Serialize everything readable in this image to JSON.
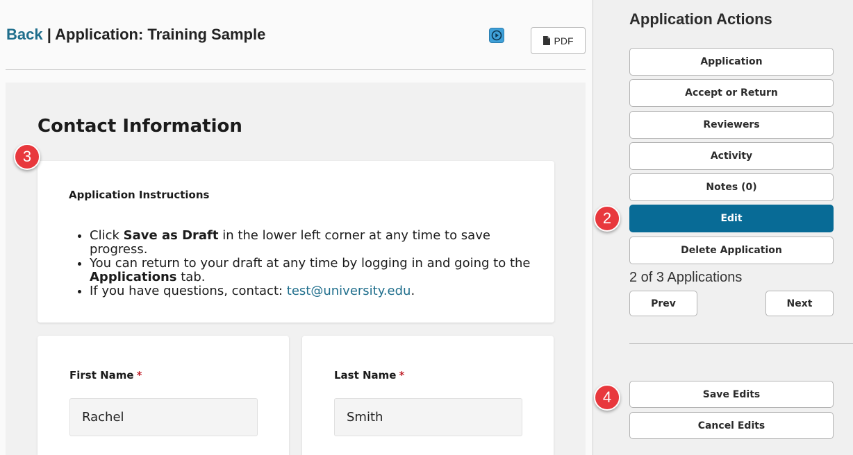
{
  "header": {
    "back_label": "Back",
    "separator": "|",
    "title": "Application: Training Sample",
    "video_icon": "play-circle-icon",
    "pdf_label": "PDF",
    "pdf_icon": "file-icon"
  },
  "main": {
    "section_title": "Contact Information",
    "instructions": {
      "heading": "Application Instructions",
      "items": [
        {
          "pre": "Click ",
          "bold": "Save as Draft",
          "post": " in the lower left corner at any time to save progress."
        },
        {
          "pre": "You can return to your draft at any time by logging in and going to the ",
          "bold": "Applications",
          "post": " tab."
        },
        {
          "pre": "If you have questions, contact: ",
          "link": "test@university.edu",
          "post": "."
        }
      ]
    },
    "fields": {
      "first_name": {
        "label": "First Name",
        "required_mark": "*",
        "value": "Rachel"
      },
      "last_name": {
        "label": "Last Name",
        "required_mark": "*",
        "value": "Smith"
      }
    }
  },
  "sidebar": {
    "title": "Application Actions",
    "buttons": {
      "application": "Application",
      "accept_return": "Accept or Return",
      "reviewers": "Reviewers",
      "activity": "Activity",
      "notes": "Notes (0)",
      "edit": "Edit",
      "delete": "Delete Application"
    },
    "counter": "2 of 3 Applications",
    "prev_label": "Prev",
    "next_label": "Next",
    "save_edits": "Save Edits",
    "cancel_edits": "Cancel Edits"
  },
  "markers": [
    "2",
    "3",
    "4"
  ],
  "colors": {
    "accent": "#086b96",
    "link": "#1f6e8c",
    "marker": "#e8383d",
    "required": "#c0202a"
  }
}
